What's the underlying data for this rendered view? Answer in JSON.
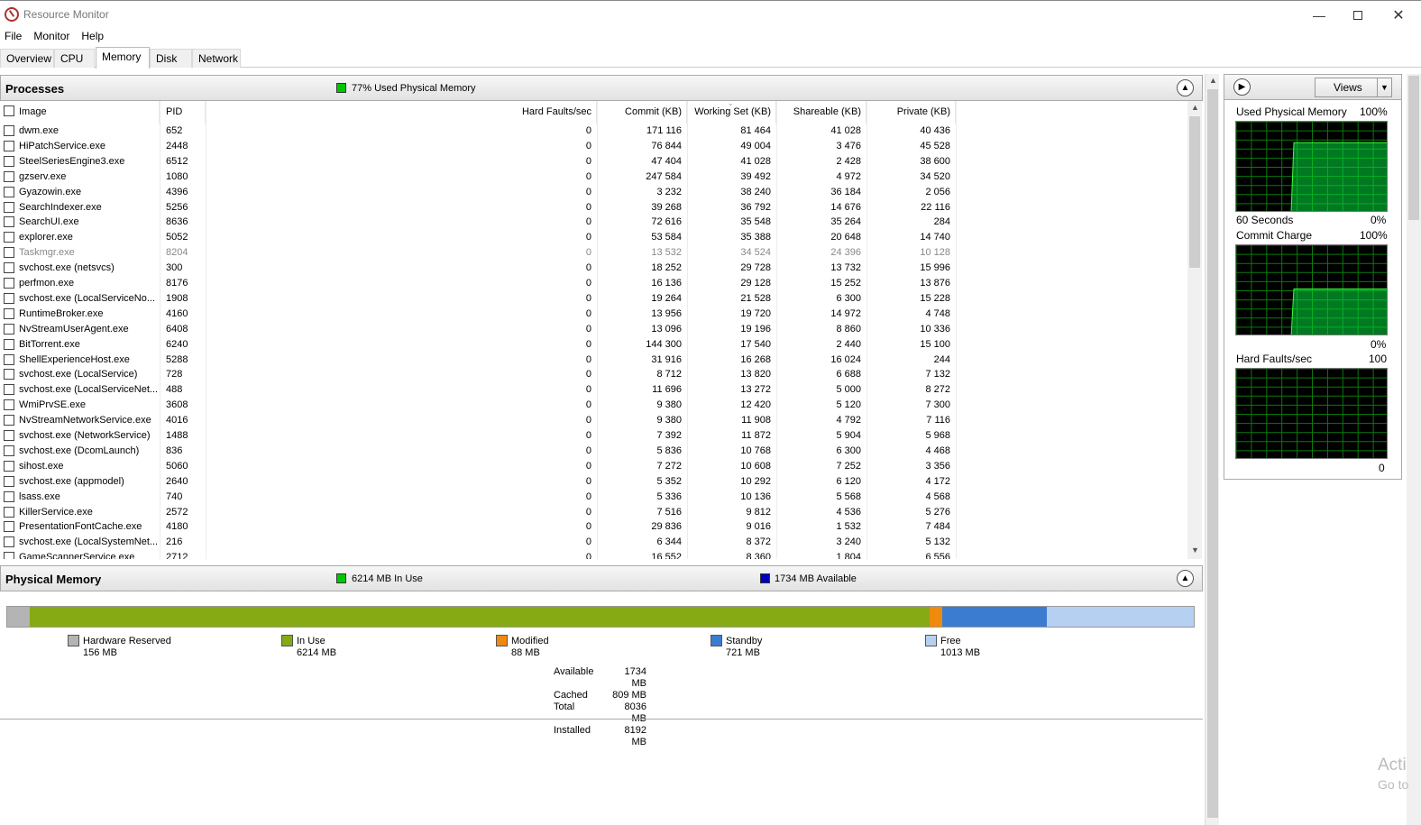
{
  "window": {
    "title": "Resource Monitor",
    "minimize_icon": "minimize-icon",
    "maximize_icon": "maximize-icon",
    "close_icon": "close-icon"
  },
  "menu": [
    "File",
    "Monitor",
    "Help"
  ],
  "tabs": [
    {
      "label": "Overview"
    },
    {
      "label": "CPU"
    },
    {
      "label": "Memory"
    },
    {
      "label": "Disk"
    },
    {
      "label": "Network"
    }
  ],
  "active_tab": "Memory",
  "processes": {
    "title": "Processes",
    "status": "77% Used Physical Memory",
    "status_color": "#00c800",
    "columns": [
      "Image",
      "PID",
      "Hard Faults/sec",
      "Commit (KB)",
      "Working Set (KB)",
      "Shareable (KB)",
      "Private (KB)"
    ],
    "sorted_column": "Working Set (KB)",
    "rows": [
      {
        "image": "dwm.exe",
        "pid": "652",
        "faults": "0",
        "commit": "171 116",
        "ws": "81 464",
        "share": "41 028",
        "priv": "40 436"
      },
      {
        "image": "HiPatchService.exe",
        "pid": "2448",
        "faults": "0",
        "commit": "76 844",
        "ws": "49 004",
        "share": "3 476",
        "priv": "45 528"
      },
      {
        "image": "SteelSeriesEngine3.exe",
        "pid": "6512",
        "faults": "0",
        "commit": "47 404",
        "ws": "41 028",
        "share": "2 428",
        "priv": "38 600"
      },
      {
        "image": "gzserv.exe",
        "pid": "1080",
        "faults": "0",
        "commit": "247 584",
        "ws": "39 492",
        "share": "4 972",
        "priv": "34 520"
      },
      {
        "image": "Gyazowin.exe",
        "pid": "4396",
        "faults": "0",
        "commit": "3 232",
        "ws": "38 240",
        "share": "36 184",
        "priv": "2 056"
      },
      {
        "image": "SearchIndexer.exe",
        "pid": "5256",
        "faults": "0",
        "commit": "39 268",
        "ws": "36 792",
        "share": "14 676",
        "priv": "22 116"
      },
      {
        "image": "SearchUI.exe",
        "pid": "8636",
        "faults": "0",
        "commit": "72 616",
        "ws": "35 548",
        "share": "35 264",
        "priv": "284"
      },
      {
        "image": "explorer.exe",
        "pid": "5052",
        "faults": "0",
        "commit": "53 584",
        "ws": "35 388",
        "share": "20 648",
        "priv": "14 740"
      },
      {
        "image": "Taskmgr.exe",
        "pid": "8204",
        "faults": "0",
        "commit": "13 532",
        "ws": "34 524",
        "share": "24 396",
        "priv": "10 128",
        "dim": true
      },
      {
        "image": "svchost.exe (netsvcs)",
        "pid": "300",
        "faults": "0",
        "commit": "18 252",
        "ws": "29 728",
        "share": "13 732",
        "priv": "15 996"
      },
      {
        "image": "perfmon.exe",
        "pid": "8176",
        "faults": "0",
        "commit": "16 136",
        "ws": "29 128",
        "share": "15 252",
        "priv": "13 876"
      },
      {
        "image": "svchost.exe (LocalServiceNo...",
        "pid": "1908",
        "faults": "0",
        "commit": "19 264",
        "ws": "21 528",
        "share": "6 300",
        "priv": "15 228"
      },
      {
        "image": "RuntimeBroker.exe",
        "pid": "4160",
        "faults": "0",
        "commit": "13 956",
        "ws": "19 720",
        "share": "14 972",
        "priv": "4 748"
      },
      {
        "image": "NvStreamUserAgent.exe",
        "pid": "6408",
        "faults": "0",
        "commit": "13 096",
        "ws": "19 196",
        "share": "8 860",
        "priv": "10 336"
      },
      {
        "image": "BitTorrent.exe",
        "pid": "6240",
        "faults": "0",
        "commit": "144 300",
        "ws": "17 540",
        "share": "2 440",
        "priv": "15 100"
      },
      {
        "image": "ShellExperienceHost.exe",
        "pid": "5288",
        "faults": "0",
        "commit": "31 916",
        "ws": "16 268",
        "share": "16 024",
        "priv": "244"
      },
      {
        "image": "svchost.exe (LocalService)",
        "pid": "728",
        "faults": "0",
        "commit": "8 712",
        "ws": "13 820",
        "share": "6 688",
        "priv": "7 132"
      },
      {
        "image": "svchost.exe (LocalServiceNet...",
        "pid": "488",
        "faults": "0",
        "commit": "11 696",
        "ws": "13 272",
        "share": "5 000",
        "priv": "8 272"
      },
      {
        "image": "WmiPrvSE.exe",
        "pid": "3608",
        "faults": "0",
        "commit": "9 380",
        "ws": "12 420",
        "share": "5 120",
        "priv": "7 300"
      },
      {
        "image": "NvStreamNetworkService.exe",
        "pid": "4016",
        "faults": "0",
        "commit": "9 380",
        "ws": "11 908",
        "share": "4 792",
        "priv": "7 116"
      },
      {
        "image": "svchost.exe (NetworkService)",
        "pid": "1488",
        "faults": "0",
        "commit": "7 392",
        "ws": "11 872",
        "share": "5 904",
        "priv": "5 968"
      },
      {
        "image": "svchost.exe (DcomLaunch)",
        "pid": "836",
        "faults": "0",
        "commit": "5 836",
        "ws": "10 768",
        "share": "6 300",
        "priv": "4 468"
      },
      {
        "image": "sihost.exe",
        "pid": "5060",
        "faults": "0",
        "commit": "7 272",
        "ws": "10 608",
        "share": "7 252",
        "priv": "3 356"
      },
      {
        "image": "svchost.exe (appmodel)",
        "pid": "2640",
        "faults": "0",
        "commit": "5 352",
        "ws": "10 292",
        "share": "6 120",
        "priv": "4 172"
      },
      {
        "image": "lsass.exe",
        "pid": "740",
        "faults": "0",
        "commit": "5 336",
        "ws": "10 136",
        "share": "5 568",
        "priv": "4 568"
      },
      {
        "image": "KillerService.exe",
        "pid": "2572",
        "faults": "0",
        "commit": "7 516",
        "ws": "9 812",
        "share": "4 536",
        "priv": "5 276"
      },
      {
        "image": "PresentationFontCache.exe",
        "pid": "4180",
        "faults": "0",
        "commit": "29 836",
        "ws": "9 016",
        "share": "1 532",
        "priv": "7 484"
      },
      {
        "image": "svchost.exe (LocalSystemNet...",
        "pid": "216",
        "faults": "0",
        "commit": "6 344",
        "ws": "8 372",
        "share": "3 240",
        "priv": "5 132"
      },
      {
        "image": "GameScannerService.exe",
        "pid": "2712",
        "faults": "0",
        "commit": "16 552",
        "ws": "8 360",
        "share": "1 804",
        "priv": "6 556"
      }
    ]
  },
  "physical_memory": {
    "title": "Physical Memory",
    "in_use_text": "6214 MB In Use",
    "in_use_color": "#00c800",
    "available_text": "1734 MB Available",
    "available_color": "#0000c0",
    "segments": [
      {
        "name": "Hardware Reserved",
        "value": "156 MB",
        "mb": 156,
        "color": "#b4b4b4"
      },
      {
        "name": "In Use",
        "value": "6214 MB",
        "mb": 6214,
        "color": "#86aa13"
      },
      {
        "name": "Modified",
        "value": "88 MB",
        "mb": 88,
        "color": "#ef8a0f"
      },
      {
        "name": "Standby",
        "value": "721 MB",
        "mb": 721,
        "color": "#3b7cd0"
      },
      {
        "name": "Free",
        "value": "1013 MB",
        "mb": 1013,
        "color": "#b6d0f2"
      }
    ],
    "stats": [
      {
        "label": "Available",
        "value": "1734 MB"
      },
      {
        "label": "Cached",
        "value": "809 MB"
      },
      {
        "label": "Total",
        "value": "8036 MB"
      },
      {
        "label": "Installed",
        "value": "8192 MB"
      }
    ]
  },
  "side_panel": {
    "views_label": "Views",
    "graphs": [
      {
        "title": "Used Physical Memory",
        "max": "100%",
        "min": "0%",
        "time_label": "60 Seconds",
        "level": 0.77
      },
      {
        "title": "Commit Charge",
        "max": "100%",
        "min": "0%",
        "level": 0.52
      },
      {
        "title": "Hard Faults/sec",
        "max": "100",
        "min": "0",
        "level": 0.01
      }
    ]
  },
  "watermark": {
    "line1": "Acti",
    "line2": "Go to"
  }
}
